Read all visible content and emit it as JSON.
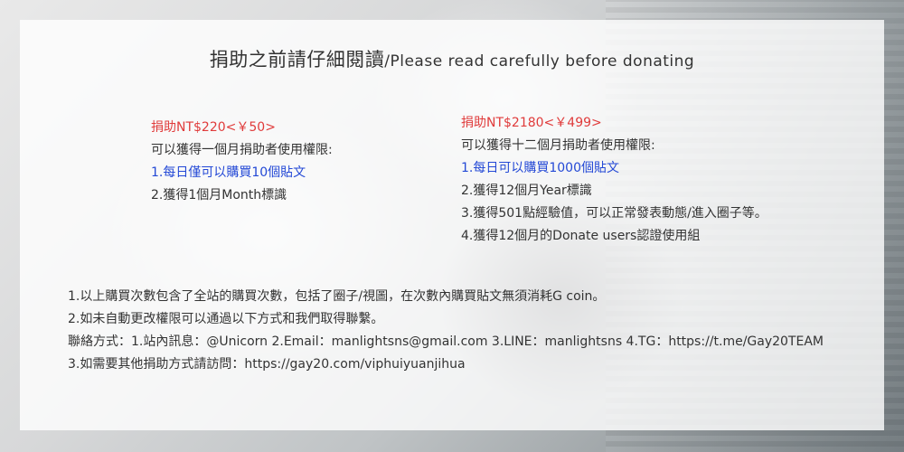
{
  "title": {
    "zh": "捐助之前請仔細閱讀",
    "separator": "/",
    "en": "Please read carefully before donating"
  },
  "tiers": [
    {
      "price": "捐助NT$220<￥50>",
      "intro": "可以獲得一個月捐助者使用權限:",
      "items": [
        "1.每日僅可以購買10個貼文",
        "2.獲得1個月Month標識"
      ]
    },
    {
      "price": "捐助NT$2180<￥499>",
      "intro": "可以獲得十二個月捐助者使用權限:",
      "items": [
        "1.每日可以購買1000個貼文",
        "2.獲得12個月Year標識",
        "3.獲得501點經驗值，可以正常發表動態/進入圈子等。",
        "4.獲得12個月的Donate users認證使用組"
      ]
    }
  ],
  "notes": [
    "1.以上購買次數包含了全站的購買次數，包括了圈子/視圖，在次數內購買貼文無須消耗G coin。",
    "2.如未自動更改權限可以通過以下方式和我們取得聯繫。",
    "聯絡方式：1.站內訊息：@Unicorn  2.Email：manlightsns@gmail.com  3.LINE：manlightsns  4.TG：https://t.me/Gay20TEAM",
    "3.如需要其他捐助方式請訪問：https://gay20.com/viphuiyuanjihua"
  ],
  "colors": {
    "price": "#e03b3b",
    "highlight": "#2449d6",
    "text": "#333333",
    "panel": "rgba(255,255,255,0.80)"
  }
}
